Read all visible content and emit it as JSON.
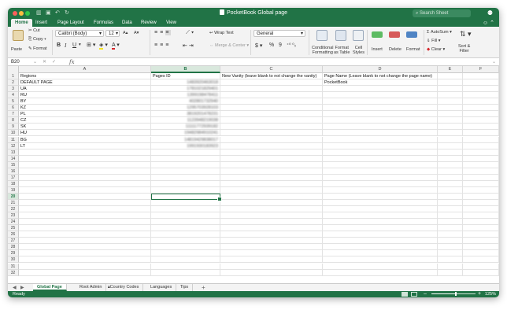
{
  "window": {
    "title": "PocketBook Global page",
    "search_placeholder": "Search Sheet"
  },
  "ribbon_tabs": [
    "Home",
    "Insert",
    "Page Layout",
    "Formulas",
    "Data",
    "Review",
    "View"
  ],
  "ribbon": {
    "paste": "Paste",
    "cut": "Cut",
    "copy": "Copy",
    "format": "Format",
    "font_name": "Calibri (Body)",
    "font_size": "12",
    "wrap_text": "Wrap Text",
    "merge_center": "Merge & Center",
    "number_format": "General",
    "conditional_formatting_1": "Conditional",
    "conditional_formatting_2": "Formatting",
    "format_as_table_1": "Format",
    "format_as_table_2": "as Table",
    "cell_styles_1": "Cell",
    "cell_styles_2": "Styles",
    "insert": "Insert",
    "delete": "Delete",
    "format_cells": "Format",
    "autosum": "AutoSum",
    "fill": "Fill",
    "clear": "Clear",
    "sort_filter_1": "Sort &",
    "sort_filter_2": "Filter",
    "bold": "B",
    "italic": "I",
    "underline": "U",
    "currency": "$",
    "percent": "%",
    "comma": "9"
  },
  "formula_bar": {
    "name_box": "B20",
    "fx": "fx",
    "value": ""
  },
  "columns": [
    "A",
    "B",
    "C",
    "D",
    "E",
    "F"
  ],
  "selected_column": "B",
  "selected_row": 20,
  "rows": [
    {
      "n": "1",
      "a": "Regions",
      "b": "Pages ID",
      "c": "New Vanity (leave blank to not change the vanity)",
      "d": "Page Name (Leave blank to not change the page name)"
    },
    {
      "n": "2",
      "a": "DEFAULT PAGE",
      "b": "1483920463018",
      "c": "",
      "d": "PocketBook"
    },
    {
      "n": "3",
      "a": "UA",
      "b": "1781021829401",
      "c": "",
      "d": ""
    },
    {
      "n": "4",
      "a": "RU",
      "b": "1399198478411",
      "c": "",
      "d": ""
    },
    {
      "n": "5",
      "a": "BY",
      "b": "402801732940",
      "c": "",
      "d": ""
    },
    {
      "n": "6",
      "a": "KZ",
      "b": "1295703928103",
      "c": "",
      "d": ""
    },
    {
      "n": "7",
      "a": "PL",
      "b": "3819201478231",
      "c": "",
      "d": ""
    },
    {
      "n": "8",
      "a": "CZ",
      "b": "1123948219038",
      "c": "",
      "d": ""
    },
    {
      "n": "9",
      "a": "SK",
      "b": "11111772939182",
      "c": "",
      "d": ""
    },
    {
      "n": "10",
      "a": "HU",
      "b": "19482984910241",
      "c": "",
      "d": ""
    },
    {
      "n": "11",
      "a": "BG",
      "b": "14819429838017",
      "c": "",
      "d": ""
    },
    {
      "n": "12",
      "a": "LT",
      "b": "1991930183923",
      "c": "",
      "d": ""
    },
    {
      "n": "13",
      "a": "",
      "b": "",
      "c": "",
      "d": ""
    },
    {
      "n": "14",
      "a": "",
      "b": "",
      "c": "",
      "d": ""
    },
    {
      "n": "15",
      "a": "",
      "b": "",
      "c": "",
      "d": ""
    },
    {
      "n": "16",
      "a": "",
      "b": "",
      "c": "",
      "d": ""
    },
    {
      "n": "17",
      "a": "",
      "b": "",
      "c": "",
      "d": ""
    },
    {
      "n": "18",
      "a": "",
      "b": "",
      "c": "",
      "d": ""
    },
    {
      "n": "19",
      "a": "",
      "b": "",
      "c": "",
      "d": ""
    },
    {
      "n": "20",
      "a": "",
      "b": "",
      "c": "",
      "d": ""
    },
    {
      "n": "21",
      "a": "",
      "b": "",
      "c": "",
      "d": ""
    },
    {
      "n": "22",
      "a": "",
      "b": "",
      "c": "",
      "d": ""
    },
    {
      "n": "23",
      "a": "",
      "b": "",
      "c": "",
      "d": ""
    },
    {
      "n": "24",
      "a": "",
      "b": "",
      "c": "",
      "d": ""
    },
    {
      "n": "25",
      "a": "",
      "b": "",
      "c": "",
      "d": ""
    },
    {
      "n": "26",
      "a": "",
      "b": "",
      "c": "",
      "d": ""
    },
    {
      "n": "27",
      "a": "",
      "b": "",
      "c": "",
      "d": ""
    },
    {
      "n": "28",
      "a": "",
      "b": "",
      "c": "",
      "d": ""
    },
    {
      "n": "29",
      "a": "",
      "b": "",
      "c": "",
      "d": ""
    },
    {
      "n": "30",
      "a": "",
      "b": "",
      "c": "",
      "d": ""
    },
    {
      "n": "31",
      "a": "",
      "b": "",
      "c": "",
      "d": ""
    },
    {
      "n": "32",
      "a": "",
      "b": "",
      "c": "",
      "d": ""
    }
  ],
  "sheet_tabs": [
    "Global Page",
    "Root Admin",
    "Country Codes",
    "Languages",
    "Tips"
  ],
  "active_sheet": "Global Page",
  "status": {
    "text": "Ready",
    "zoom": "125%",
    "zoom_level": 0.55
  },
  "colors": {
    "accent": "#217346",
    "selection_fill": "#d9e8dd"
  }
}
